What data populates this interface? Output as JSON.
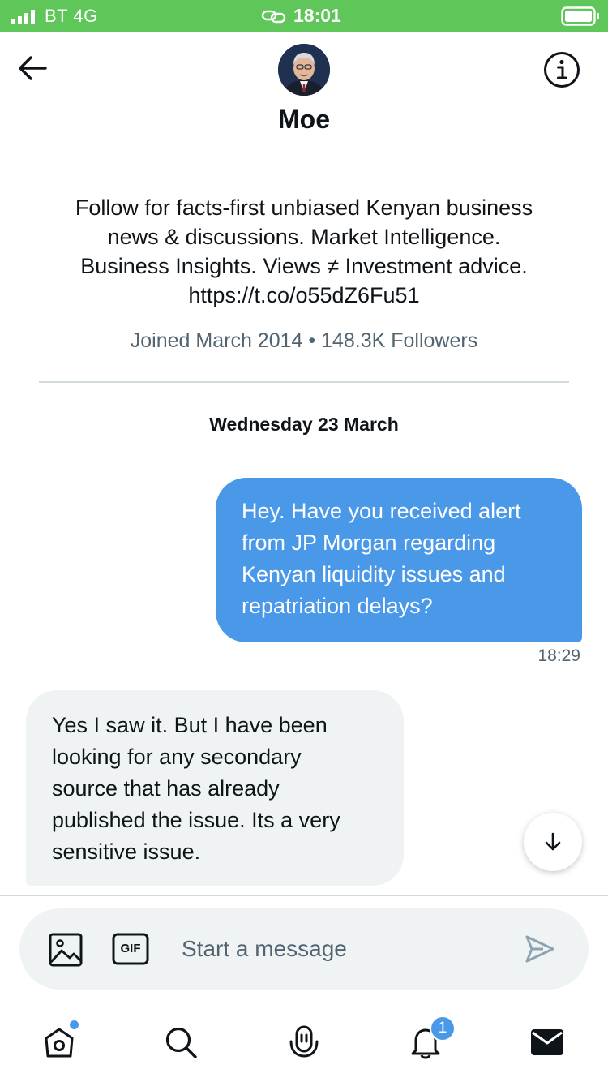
{
  "status_bar": {
    "carrier": "BT  4G",
    "time": "18:01"
  },
  "profile": {
    "name": "Moe",
    "bio_lines": [
      "Follow for facts-first unbiased Kenyan business",
      "news & discussions. Market Intelligence.",
      "Business Insights. Views ≠ Investment advice.",
      "https://t.co/o55dZ6Fu51"
    ],
    "meta": "Joined March 2014 • 148.3K Followers"
  },
  "conversation": {
    "date_label": "Wednesday 23 March",
    "messages": [
      {
        "direction": "sent",
        "lines": [
          "Hey. Have you received alert",
          "from JP Morgan regarding",
          "Kenyan liquidity issues and",
          "repatriation delays?"
        ],
        "time": "18:29"
      },
      {
        "direction": "received",
        "lines": [
          "Yes I saw it. But I have been",
          "looking for any secondary",
          "source that has already",
          "published the issue. Its a very",
          "sensitive issue."
        ]
      }
    ]
  },
  "composer": {
    "placeholder": "Start a message",
    "value": "",
    "gif_label": "GIF"
  },
  "bottom_nav": {
    "notifications_count": "1"
  },
  "colors": {
    "status_bar": "#5fc65a",
    "accent": "#4a99e9",
    "sent_bubble": "#4a99e9",
    "received_bubble": "#eff3f4",
    "muted_text": "#536471"
  },
  "icons": [
    "signal-icon",
    "link-icon",
    "battery-icon",
    "back-arrow-icon",
    "info-icon",
    "image-icon",
    "gif-icon",
    "send-icon",
    "arrow-down-icon",
    "home-icon",
    "search-icon",
    "spaces-icon",
    "bell-icon",
    "mail-icon"
  ]
}
